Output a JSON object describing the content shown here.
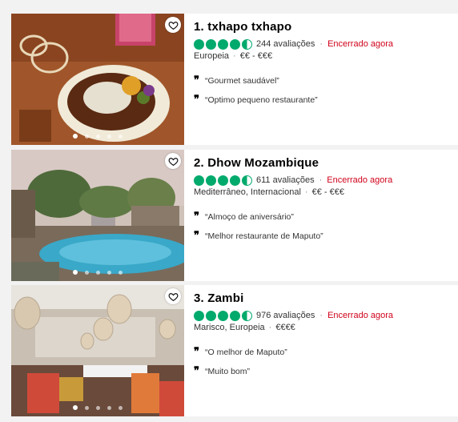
{
  "restaurants": [
    {
      "title": "1. txhapo txhapo",
      "reviews": "244 avaliações",
      "status": "Encerrado agora",
      "cuisine": "Europeia",
      "price": "€€ - €€€",
      "quotes": [
        "“Gourmet saudável”",
        "“Optimo pequeno restaurante”"
      ],
      "rating": 4.5
    },
    {
      "title": "2. Dhow Mozambique",
      "reviews": "611 avaliações",
      "status": "Encerrado agora",
      "cuisine": "Mediterrâneo, Internacional",
      "price": "€€ - €€€",
      "quotes": [
        "“Almoço de aniversário”",
        "“Melhor restaurante de Maputo”"
      ],
      "rating": 4.5
    },
    {
      "title": "3. Zambi",
      "reviews": "976 avaliações",
      "status": "Encerrado agora",
      "cuisine": "Marisco, Europeia",
      "price": "€€€€",
      "quotes": [
        "“O melhor de Maputo”",
        "“Muito bom”"
      ],
      "rating": 4.5
    }
  ],
  "quote_mark": "❞",
  "bullet_separator": "·",
  "colors": {
    "bubble": "#00aa6c",
    "closed": "#d0021b"
  },
  "icons": {
    "favorite": "heart-icon",
    "quote": "quote-icon"
  }
}
